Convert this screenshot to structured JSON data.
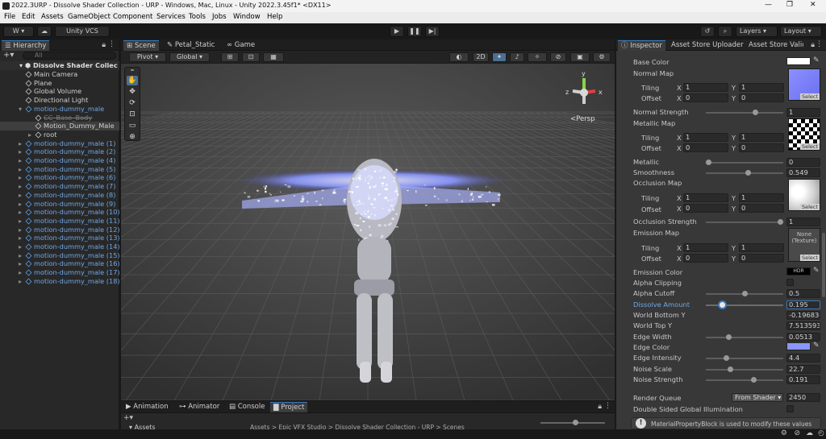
{
  "window": {
    "title": "2022.3URP - Dissolve Shader Collection - URP - Windows, Mac, Linux - Unity 2022.3.45f1* <DX11>",
    "minimize": "—",
    "maximize": "❐",
    "close": "✕"
  },
  "menu": [
    "File",
    "Edit",
    "Assets",
    "GameObject",
    "Component",
    "Services",
    "Tools",
    "Jobs",
    "Window",
    "Help"
  ],
  "toolbar": {
    "account": "W",
    "vcs": "Unity VCS",
    "layers": "Layers",
    "layout": "Layout"
  },
  "hierarchy": {
    "tab": "Hierarchy",
    "search_placeholder": "All",
    "scene": "Dissolve Shader Collec",
    "items": [
      {
        "label": "Main Camera",
        "indent": 1,
        "blue": false
      },
      {
        "label": "Plane",
        "indent": 1,
        "blue": false
      },
      {
        "label": "Global Volume",
        "indent": 1,
        "blue": false
      },
      {
        "label": "Directional Light",
        "indent": 1,
        "blue": false
      },
      {
        "label": "motion-dummy_male",
        "indent": 1,
        "blue": true,
        "expanded": true
      },
      {
        "label": "CC_Base_Body",
        "indent": 2,
        "blue": false,
        "dim": true
      },
      {
        "label": "Motion_Dummy_Male",
        "indent": 2,
        "blue": false,
        "selected": true
      },
      {
        "label": "root",
        "indent": 2,
        "blue": false,
        "arrow": true
      },
      {
        "label": "motion-dummy_male (1)",
        "indent": 1,
        "blue": true,
        "arrow": true
      },
      {
        "label": "motion-dummy_male (2)",
        "indent": 1,
        "blue": true,
        "arrow": true
      },
      {
        "label": "motion-dummy_male (4)",
        "indent": 1,
        "blue": true,
        "arrow": true
      },
      {
        "label": "motion-dummy_male (5)",
        "indent": 1,
        "blue": true,
        "arrow": true
      },
      {
        "label": "motion-dummy_male (6)",
        "indent": 1,
        "blue": true,
        "arrow": true
      },
      {
        "label": "motion-dummy_male (7)",
        "indent": 1,
        "blue": true,
        "arrow": true
      },
      {
        "label": "motion-dummy_male (8)",
        "indent": 1,
        "blue": true,
        "arrow": true
      },
      {
        "label": "motion-dummy_male (9)",
        "indent": 1,
        "blue": true,
        "arrow": true
      },
      {
        "label": "motion-dummy_male (10)",
        "indent": 1,
        "blue": true,
        "arrow": true
      },
      {
        "label": "motion-dummy_male (11)",
        "indent": 1,
        "blue": true,
        "arrow": true
      },
      {
        "label": "motion-dummy_male (12)",
        "indent": 1,
        "blue": true,
        "arrow": true
      },
      {
        "label": "motion-dummy_male (13)",
        "indent": 1,
        "blue": true,
        "arrow": true
      },
      {
        "label": "motion-dummy_male (14)",
        "indent": 1,
        "blue": true,
        "arrow": true
      },
      {
        "label": "motion-dummy_male (15)",
        "indent": 1,
        "blue": true,
        "arrow": true
      },
      {
        "label": "motion-dummy_male (16)",
        "indent": 1,
        "blue": true,
        "arrow": true
      },
      {
        "label": "motion-dummy_male (17)",
        "indent": 1,
        "blue": true,
        "arrow": true
      },
      {
        "label": "motion-dummy_male (18)",
        "indent": 1,
        "blue": true,
        "arrow": true
      }
    ]
  },
  "scene": {
    "tabs": [
      "Scene",
      "Petal_Static",
      "Game"
    ],
    "pivot": "Pivot",
    "global": "Global",
    "mode_2d": "2D",
    "persp": "<Persp",
    "gizmo_axes": [
      "y",
      "x",
      "z"
    ]
  },
  "bottom": {
    "tabs": [
      "Animation",
      "Animator",
      "Console",
      "Project"
    ],
    "assets": "Assets",
    "path": "Assets > Epic VFX Studio > Dissolve Shader Collection - URP > Scenes"
  },
  "inspector": {
    "tabs": [
      "Inspector",
      "Asset Store Uploader",
      "Asset Store Valid"
    ],
    "base_color": "Base Color",
    "normal_map": "Normal Map",
    "tiling": "Tiling",
    "offset": "Offset",
    "x": "X",
    "y": "Y",
    "normal_tiling": [
      "1",
      "1"
    ],
    "normal_offset": [
      "0",
      "0"
    ],
    "normal_strength": {
      "label": "Normal Strength",
      "value": "1",
      "level": 0.65
    },
    "metallic_map": "Metallic Map",
    "metallic_tiling": [
      "1",
      "1"
    ],
    "metallic_offset": [
      "0",
      "0"
    ],
    "metallic": {
      "label": "Metallic",
      "value": "0",
      "level": 0.0
    },
    "smoothness": {
      "label": "Smoothness",
      "value": "0.549",
      "level": 0.549
    },
    "occlusion_map": "Occlusion Map",
    "occlusion_tiling": [
      "1",
      "1"
    ],
    "occlusion_offset": [
      "0",
      "0"
    ],
    "occlusion_strength": {
      "label": "Occlusion Strength",
      "value": "1",
      "level": 1.0
    },
    "emission_map": "Emission Map",
    "emission_none": "None\n(Texture)",
    "emission_tiling": [
      "1",
      "1"
    ],
    "emission_offset": [
      "0",
      "0"
    ],
    "emission_color": "Emission Color",
    "hdr": "HDR",
    "alpha_clipping": "Alpha Clipping",
    "alpha_cutoff": {
      "label": "Alpha Cutoff",
      "value": "0.5",
      "level": 0.5
    },
    "dissolve_amount": {
      "label": "Dissolve Amount",
      "value": "0.195",
      "level": 0.195
    },
    "world_bottom": {
      "label": "World Bottom Y",
      "value": "-0.196830"
    },
    "world_top": {
      "label": "World Top Y",
      "value": "7.513593"
    },
    "edge_width": {
      "label": "Edge Width",
      "value": "0.0513",
      "level": 0.28
    },
    "edge_color": "Edge Color",
    "edge_intensity": {
      "label": "Edge Intensity",
      "value": "4.4",
      "level": 0.25
    },
    "noise_scale": {
      "label": "Noise Scale",
      "value": "22.7",
      "level": 0.3
    },
    "noise_strength": {
      "label": "Noise Strength",
      "value": "0.191",
      "level": 0.63
    },
    "render_queue": {
      "label": "Render Queue",
      "mode": "From Shader",
      "value": "2450"
    },
    "double_sided": "Double Sided Global Illumination",
    "info": "MaterialPropertyBlock is used to modify these values",
    "select": "Select",
    "colors": {
      "base": "#ffffff",
      "edge": "#8a96ff",
      "dissolve_label": "#6fa7e6"
    }
  }
}
